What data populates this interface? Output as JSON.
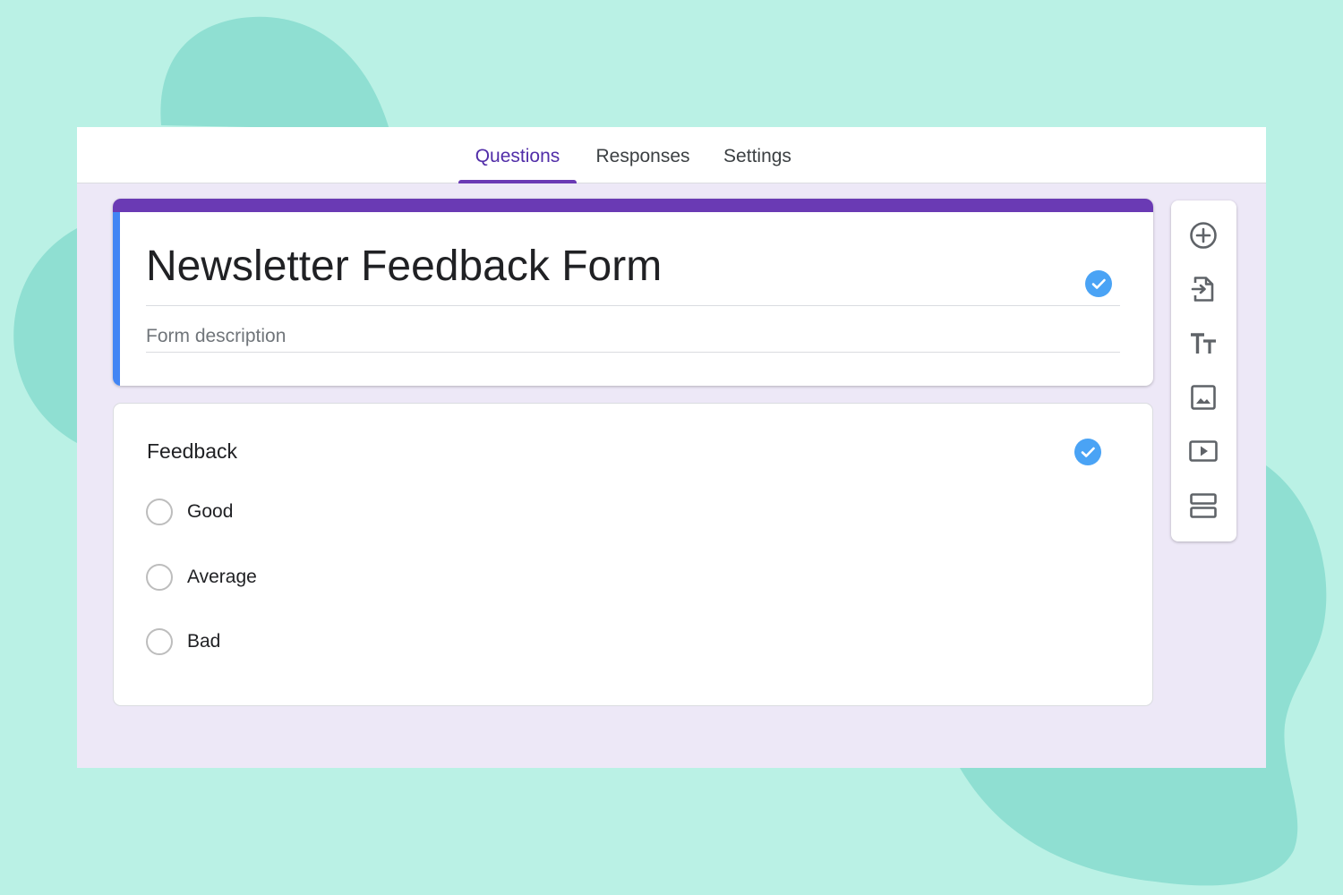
{
  "tabs": [
    {
      "label": "Questions",
      "active": true
    },
    {
      "label": "Responses",
      "active": false
    },
    {
      "label": "Settings",
      "active": false
    }
  ],
  "form": {
    "title": "Newsletter Feedback Form",
    "description_placeholder": "Form description"
  },
  "question": {
    "title": "Feedback",
    "options": [
      "Good",
      "Average",
      "Bad"
    ]
  },
  "toolbar": {
    "icons": [
      "add-question-icon",
      "import-questions-icon",
      "add-title-icon",
      "add-image-icon",
      "add-video-icon",
      "add-section-icon"
    ]
  },
  "colors": {
    "background": "#baf1e5",
    "blob": "#8fdfd2",
    "accent": "#6a3ab4",
    "active_tab_text": "#512da8",
    "left_bar": "#4285f4",
    "check": "#4aa3f5",
    "canvas": "#ede8f7"
  }
}
